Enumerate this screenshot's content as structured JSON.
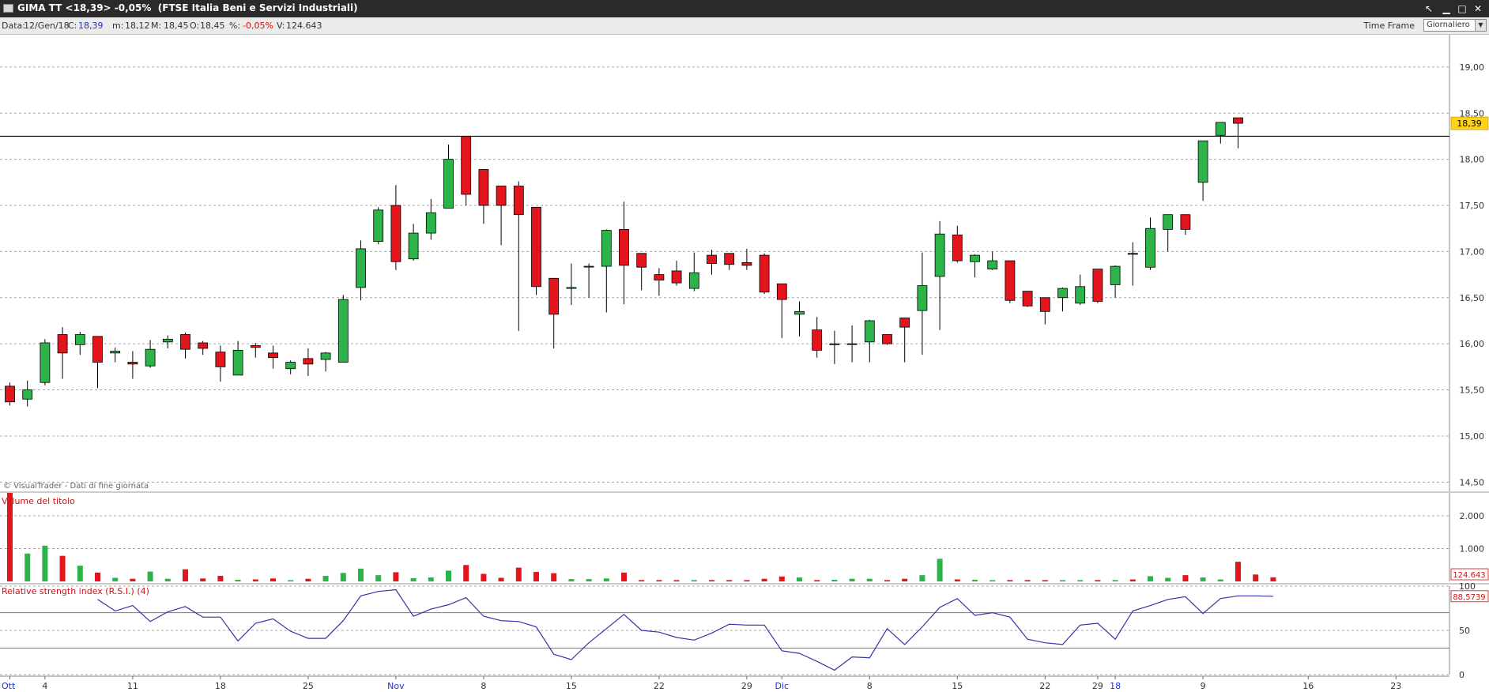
{
  "window": {
    "title": "GIMA TT <18,39> -0,05%  (FTSE Italia Beni e Servizi Industriali)",
    "controls": {
      "minimize": "▁",
      "restore": "□",
      "close": "✕",
      "back": "↖"
    }
  },
  "infobar": {
    "date_label": "Data:",
    "date_value": "12/Gen/18",
    "close_label": "C:",
    "close_value": "18,39",
    "min_label": "m:",
    "min_value": "18,12",
    "max_label": "M:",
    "max_value": "18,45",
    "open_label": "O:",
    "open_value": "18,45",
    "pct_label": "%:",
    "pct_value": "-0,05%",
    "vol_label": "V:",
    "vol_value": "124.643",
    "timeframe_label": "Time Frame",
    "timeframe_value": "Giornaliero"
  },
  "colors": {
    "up": "#2cb34a",
    "down": "#e3141b",
    "rsi_line": "#3333aa",
    "price_tag": "#ffd21c",
    "title_bar": "#2a2a2a"
  },
  "chart_data": [
    {
      "type": "candlestick",
      "title": "",
      "watermark": "© VisualTrader - Dati di fine giornata",
      "ylim": [
        14.4,
        19.35
      ],
      "y_ticks": [
        "19,00",
        "18,50",
        "18,00",
        "17,50",
        "17,00",
        "16,50",
        "16,00",
        "15,50",
        "15,00",
        "14,50"
      ],
      "y_tick_values": [
        19.0,
        18.5,
        18.0,
        17.5,
        17.0,
        16.5,
        16.0,
        15.5,
        15.0,
        14.5
      ],
      "last_price_label": "18,39",
      "last_price": 18.39,
      "horizontal_line": 18.25,
      "grid": true,
      "candles": [
        {
          "date": "2017-10-02",
          "o": 15.54,
          "h": 15.58,
          "l": 15.33,
          "c": 15.37
        },
        {
          "date": "2017-10-03",
          "o": 15.4,
          "h": 15.6,
          "l": 15.32,
          "c": 15.5
        },
        {
          "date": "2017-10-04",
          "o": 15.58,
          "h": 16.05,
          "l": 15.55,
          "c": 16.01
        },
        {
          "date": "2017-10-05",
          "o": 16.1,
          "h": 16.18,
          "l": 15.62,
          "c": 15.9
        },
        {
          "date": "2017-10-06",
          "o": 15.99,
          "h": 16.13,
          "l": 15.88,
          "c": 16.1
        },
        {
          "date": "2017-10-09",
          "o": 16.08,
          "h": 16.08,
          "l": 15.52,
          "c": 15.8
        },
        {
          "date": "2017-10-10",
          "o": 15.9,
          "h": 15.96,
          "l": 15.8,
          "c": 15.92
        },
        {
          "date": "2017-10-11",
          "o": 15.8,
          "h": 15.92,
          "l": 15.62,
          "c": 15.78
        },
        {
          "date": "2017-10-12",
          "o": 15.76,
          "h": 16.04,
          "l": 15.74,
          "c": 15.94
        },
        {
          "date": "2017-10-13",
          "o": 16.02,
          "h": 16.09,
          "l": 15.95,
          "c": 16.05
        },
        {
          "date": "2017-10-16",
          "o": 16.1,
          "h": 16.12,
          "l": 15.84,
          "c": 15.94
        },
        {
          "date": "2017-10-17",
          "o": 16.01,
          "h": 16.03,
          "l": 15.88,
          "c": 15.95
        },
        {
          "date": "2017-10-18",
          "o": 15.91,
          "h": 15.98,
          "l": 15.59,
          "c": 15.75
        },
        {
          "date": "2017-10-19",
          "o": 15.66,
          "h": 16.03,
          "l": 15.66,
          "c": 15.93
        },
        {
          "date": "2017-10-20",
          "o": 15.98,
          "h": 16.01,
          "l": 15.85,
          "c": 15.96
        },
        {
          "date": "2017-10-23",
          "o": 15.9,
          "h": 15.98,
          "l": 15.73,
          "c": 15.85
        },
        {
          "date": "2017-10-24",
          "o": 15.73,
          "h": 15.82,
          "l": 15.67,
          "c": 15.8
        },
        {
          "date": "2017-10-25",
          "o": 15.84,
          "h": 15.95,
          "l": 15.65,
          "c": 15.78
        },
        {
          "date": "2017-10-26",
          "o": 15.83,
          "h": 15.91,
          "l": 15.7,
          "c": 15.9
        },
        {
          "date": "2017-10-27",
          "o": 15.8,
          "h": 16.53,
          "l": 15.8,
          "c": 16.48
        },
        {
          "date": "2017-10-30",
          "o": 16.61,
          "h": 17.12,
          "l": 16.47,
          "c": 17.03
        },
        {
          "date": "2017-10-31",
          "o": 17.11,
          "h": 17.48,
          "l": 17.08,
          "c": 17.45
        },
        {
          "date": "2017-11-01",
          "o": 17.5,
          "h": 17.72,
          "l": 16.8,
          "c": 16.89
        },
        {
          "date": "2017-11-02",
          "o": 16.92,
          "h": 17.3,
          "l": 16.9,
          "c": 17.2
        },
        {
          "date": "2017-11-03",
          "o": 17.2,
          "h": 17.57,
          "l": 17.13,
          "c": 17.42
        },
        {
          "date": "2017-11-06",
          "o": 17.47,
          "h": 18.16,
          "l": 17.47,
          "c": 18.0
        },
        {
          "date": "2017-11-07",
          "o": 18.25,
          "h": 18.25,
          "l": 17.5,
          "c": 17.62
        },
        {
          "date": "2017-11-08",
          "o": 17.89,
          "h": 17.89,
          "l": 17.3,
          "c": 17.5
        },
        {
          "date": "2017-11-09",
          "o": 17.71,
          "h": 17.71,
          "l": 17.07,
          "c": 17.5
        },
        {
          "date": "2017-11-10",
          "o": 17.71,
          "h": 17.76,
          "l": 16.14,
          "c": 17.4
        },
        {
          "date": "2017-11-13",
          "o": 17.48,
          "h": 17.48,
          "l": 16.53,
          "c": 16.62
        },
        {
          "date": "2017-11-14",
          "o": 16.71,
          "h": 16.71,
          "l": 15.95,
          "c": 16.32
        },
        {
          "date": "2017-11-15",
          "o": 16.6,
          "h": 16.87,
          "l": 16.42,
          "c": 16.61
        },
        {
          "date": "2017-11-16",
          "o": 16.84,
          "h": 16.87,
          "l": 16.5,
          "c": 16.84
        },
        {
          "date": "2017-11-17",
          "o": 16.84,
          "h": 17.24,
          "l": 16.34,
          "c": 17.23
        },
        {
          "date": "2017-11-20",
          "o": 17.24,
          "h": 17.54,
          "l": 16.43,
          "c": 16.85
        },
        {
          "date": "2017-11-21",
          "o": 16.98,
          "h": 16.98,
          "l": 16.58,
          "c": 16.83
        },
        {
          "date": "2017-11-22",
          "o": 16.75,
          "h": 16.82,
          "l": 16.52,
          "c": 16.69
        },
        {
          "date": "2017-11-23",
          "o": 16.79,
          "h": 16.9,
          "l": 16.63,
          "c": 16.66
        },
        {
          "date": "2017-11-24",
          "o": 16.6,
          "h": 16.99,
          "l": 16.57,
          "c": 16.77
        },
        {
          "date": "2017-11-27",
          "o": 16.96,
          "h": 17.02,
          "l": 16.75,
          "c": 16.87
        },
        {
          "date": "2017-11-28",
          "o": 16.98,
          "h": 16.98,
          "l": 16.8,
          "c": 16.86
        },
        {
          "date": "2017-11-29",
          "o": 16.88,
          "h": 17.03,
          "l": 16.8,
          "c": 16.85
        },
        {
          "date": "2017-11-30",
          "o": 16.96,
          "h": 16.98,
          "l": 16.54,
          "c": 16.56
        },
        {
          "date": "2017-12-01",
          "o": 16.65,
          "h": 16.65,
          "l": 16.06,
          "c": 16.48
        },
        {
          "date": "2017-12-04",
          "o": 16.32,
          "h": 16.46,
          "l": 16.08,
          "c": 16.35
        },
        {
          "date": "2017-12-05",
          "o": 16.15,
          "h": 16.29,
          "l": 15.85,
          "c": 15.93
        },
        {
          "date": "2017-12-06",
          "o": 15.99,
          "h": 16.14,
          "l": 15.78,
          "c": 16.0
        },
        {
          "date": "2017-12-07",
          "o": 16.0,
          "h": 16.2,
          "l": 15.8,
          "c": 16.0
        },
        {
          "date": "2017-12-08",
          "o": 16.02,
          "h": 16.26,
          "l": 15.8,
          "c": 16.25
        },
        {
          "date": "2017-12-11",
          "o": 16.1,
          "h": 16.1,
          "l": 15.99,
          "c": 16.0
        },
        {
          "date": "2017-12-12",
          "o": 16.28,
          "h": 16.28,
          "l": 15.8,
          "c": 16.18
        },
        {
          "date": "2017-12-13",
          "o": 16.36,
          "h": 16.99,
          "l": 15.88,
          "c": 16.63
        },
        {
          "date": "2017-12-14",
          "o": 16.73,
          "h": 17.33,
          "l": 16.15,
          "c": 17.19
        },
        {
          "date": "2017-12-15",
          "o": 17.18,
          "h": 17.28,
          "l": 16.88,
          "c": 16.9
        },
        {
          "date": "2017-12-18",
          "o": 16.89,
          "h": 16.97,
          "l": 16.72,
          "c": 16.96
        },
        {
          "date": "2017-12-19",
          "o": 16.81,
          "h": 17.0,
          "l": 16.8,
          "c": 16.9
        },
        {
          "date": "2017-12-20",
          "o": 16.9,
          "h": 16.9,
          "l": 16.44,
          "c": 16.47
        },
        {
          "date": "2017-12-21",
          "o": 16.57,
          "h": 16.57,
          "l": 16.4,
          "c": 16.41
        },
        {
          "date": "2017-12-22",
          "o": 16.5,
          "h": 16.5,
          "l": 16.21,
          "c": 16.35
        },
        {
          "date": "2017-12-27",
          "o": 16.5,
          "h": 16.61,
          "l": 16.35,
          "c": 16.6
        },
        {
          "date": "2017-12-28",
          "o": 16.44,
          "h": 16.75,
          "l": 16.42,
          "c": 16.62
        },
        {
          "date": "2017-12-29",
          "o": 16.81,
          "h": 16.81,
          "l": 16.44,
          "c": 16.46
        },
        {
          "date": "2018-01-02",
          "o": 16.64,
          "h": 16.85,
          "l": 16.5,
          "c": 16.84
        },
        {
          "date": "2018-01-03",
          "o": 16.98,
          "h": 17.1,
          "l": 16.63,
          "c": 16.97
        },
        {
          "date": "2018-01-04",
          "o": 16.83,
          "h": 17.37,
          "l": 16.8,
          "c": 17.25
        },
        {
          "date": "2018-01-05",
          "o": 17.24,
          "h": 17.4,
          "l": 17.0,
          "c": 17.4
        },
        {
          "date": "2018-01-08",
          "o": 17.4,
          "h": 17.4,
          "l": 17.18,
          "c": 17.24
        },
        {
          "date": "2018-01-09",
          "o": 17.75,
          "h": 18.2,
          "l": 17.55,
          "c": 18.2
        },
        {
          "date": "2018-01-10",
          "o": 18.26,
          "h": 18.4,
          "l": 18.17,
          "c": 18.4
        },
        {
          "date": "2018-01-11",
          "o": 18.45,
          "h": 18.45,
          "l": 18.12,
          "c": 18.39
        }
      ],
      "x_ticks": [
        {
          "label": "Ott",
          "date": "2017-10-02",
          "month": true
        },
        {
          "label": "4",
          "date": "2017-10-04",
          "month": false
        },
        {
          "label": "11",
          "date": "2017-10-11",
          "month": false
        },
        {
          "label": "18",
          "date": "2017-10-18",
          "month": false
        },
        {
          "label": "25",
          "date": "2017-10-25",
          "month": false
        },
        {
          "label": "Nov",
          "date": "2017-11-01",
          "month": true
        },
        {
          "label": "8",
          "date": "2017-11-08",
          "month": false
        },
        {
          "label": "15",
          "date": "2017-11-15",
          "month": false
        },
        {
          "label": "22",
          "date": "2017-11-22",
          "month": false
        },
        {
          "label": "29",
          "date": "2017-11-29",
          "month": false
        },
        {
          "label": "Dic",
          "date": "2017-12-01",
          "month": true
        },
        {
          "label": "8",
          "date": "2017-12-08",
          "month": false
        },
        {
          "label": "15",
          "date": "2017-12-15",
          "month": false
        },
        {
          "label": "22",
          "date": "2017-12-22",
          "month": false
        },
        {
          "label": "29",
          "date": "2017-12-29",
          "month": false
        },
        {
          "label": "18",
          "date": "2018-01-02",
          "month": true
        },
        {
          "label": "9",
          "date": "2018-01-09",
          "month": false
        },
        {
          "label": "16",
          "date": "2018-01-16",
          "month": false
        },
        {
          "label": "23",
          "date": "2018-01-23",
          "month": false
        }
      ]
    },
    {
      "type": "bar",
      "title": "Volume del titolo",
      "ylim": [
        0,
        2700000
      ],
      "y_ticks": [
        "2.000",
        "1.000"
      ],
      "y_tick_values": [
        2000000,
        1000000
      ],
      "last_value_label": "124.643",
      "values": [
        2700000,
        850000,
        1090000,
        780000,
        480000,
        270000,
        110000,
        80000,
        300000,
        80000,
        370000,
        90000,
        170000,
        50000,
        60000,
        90000,
        40000,
        80000,
        170000,
        260000,
        390000,
        190000,
        280000,
        100000,
        120000,
        330000,
        500000,
        230000,
        110000,
        420000,
        290000,
        250000,
        70000,
        70000,
        90000,
        270000,
        40000,
        40000,
        40000,
        40000,
        40000,
        40000,
        40000,
        80000,
        150000,
        120000,
        40000,
        50000,
        80000,
        80000,
        40000,
        80000,
        190000,
        690000,
        60000,
        50000,
        40000,
        40000,
        40000,
        40000,
        40000,
        40000,
        40000,
        40000,
        60000,
        160000,
        110000,
        190000,
        120000,
        60000,
        600000,
        210000,
        124643
      ]
    },
    {
      "type": "line",
      "title": "Relative strength index (R.S.I.) (4)",
      "ylim": [
        0,
        100
      ],
      "y_ticks": [
        "100",
        "50",
        "0"
      ],
      "y_tick_values": [
        100,
        50,
        0
      ],
      "reference_lines": [
        70,
        30
      ],
      "last_value_label": "88,5739",
      "series": [
        {
          "name": "Relative strength index (R.S.I.) (4)",
          "values": [
            null,
            null,
            null,
            null,
            null,
            85,
            72,
            78,
            60,
            71,
            77,
            65,
            65,
            38,
            58,
            63,
            49,
            41,
            41,
            61,
            89,
            94,
            96,
            66,
            74,
            79,
            87,
            66,
            61,
            60,
            54,
            23,
            17,
            36,
            52,
            68,
            50,
            48,
            42,
            39,
            47,
            57,
            56,
            56,
            27,
            24,
            15,
            5,
            20,
            19,
            52,
            34,
            54,
            76,
            86,
            67,
            70,
            65,
            40,
            36,
            34,
            56,
            58,
            40,
            72,
            78,
            85,
            88,
            69,
            86,
            89,
            89,
            88.5739
          ]
        }
      ]
    }
  ]
}
